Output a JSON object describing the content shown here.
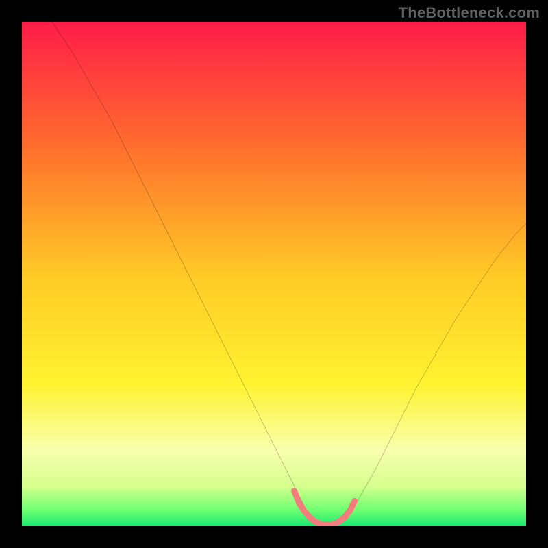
{
  "watermark": "TheBottleneck.com",
  "chart_data": {
    "type": "line",
    "title": "",
    "xlabel": "",
    "ylabel": "",
    "xlim": [
      0,
      100
    ],
    "ylim": [
      0,
      100
    ],
    "legend": false,
    "grid": false,
    "background_gradient": {
      "stops": [
        {
          "pos": 0.0,
          "color": "#ff1c49"
        },
        {
          "pos": 0.25,
          "color": "#ff6f2d"
        },
        {
          "pos": 0.5,
          "color": "#ffc926"
        },
        {
          "pos": 0.72,
          "color": "#fff331"
        },
        {
          "pos": 0.85,
          "color": "#f9ffae"
        },
        {
          "pos": 0.92,
          "color": "#d6ff8e"
        },
        {
          "pos": 0.97,
          "color": "#6bff70"
        },
        {
          "pos": 1.0,
          "color": "#17e86f"
        }
      ]
    },
    "series": [
      {
        "name": "bottleneck-curve",
        "color": "#000000",
        "width": 1.5,
        "x": [
          6,
          10,
          14,
          18,
          22,
          26,
          30,
          34,
          38,
          42,
          46,
          50,
          54,
          56,
          58,
          60,
          62,
          64,
          66,
          70,
          74,
          78,
          82,
          86,
          90,
          94,
          98,
          100
        ],
        "y": [
          100,
          94,
          87,
          80,
          72,
          64,
          56,
          48,
          40,
          32,
          24,
          16,
          8,
          4,
          1,
          0,
          0,
          1,
          4,
          11,
          19,
          27,
          34,
          41,
          47,
          53,
          58,
          60
        ]
      },
      {
        "name": "min-band",
        "color": "#f37d7d",
        "width": 8,
        "x": [
          54,
          55,
          56,
          57,
          58,
          59,
          60,
          61,
          62,
          63,
          64,
          65,
          66
        ],
        "y": [
          7,
          4.5,
          3,
          1.8,
          1,
          0.5,
          0.3,
          0.3,
          0.5,
          1,
          1.8,
          3,
          5
        ]
      }
    ]
  }
}
